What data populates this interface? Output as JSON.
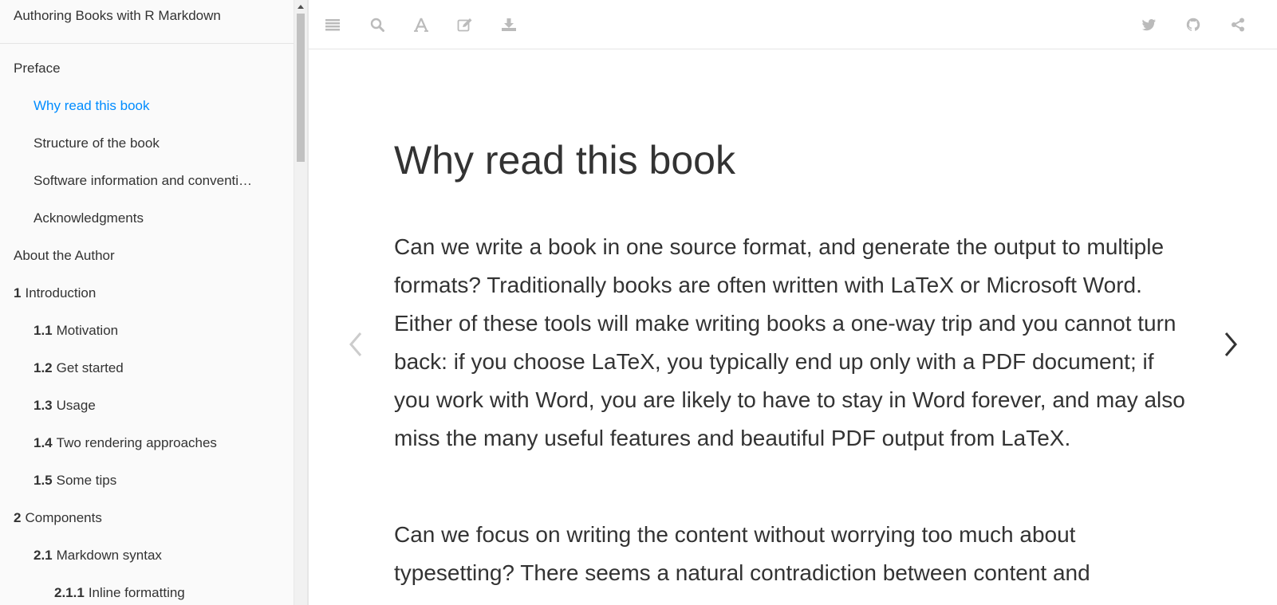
{
  "sidebar": {
    "title": "Authoring Books with R Markdown",
    "items": [
      {
        "number": "",
        "label": "Preface",
        "level": 1
      },
      {
        "number": "",
        "label": "Why read this book",
        "level": 2,
        "active": true
      },
      {
        "number": "",
        "label": "Structure of the book",
        "level": 2
      },
      {
        "number": "",
        "label": "Software information and conventi…",
        "level": 2
      },
      {
        "number": "",
        "label": "Acknowledgments",
        "level": 2
      },
      {
        "number": "",
        "label": "About the Author",
        "level": 1
      },
      {
        "number": "1",
        "label": "Introduction",
        "level": 1
      },
      {
        "number": "1.1",
        "label": "Motivation",
        "level": 2
      },
      {
        "number": "1.2",
        "label": "Get started",
        "level": 2
      },
      {
        "number": "1.3",
        "label": "Usage",
        "level": 2
      },
      {
        "number": "1.4",
        "label": "Two rendering approaches",
        "level": 2
      },
      {
        "number": "1.5",
        "label": "Some tips",
        "level": 2
      },
      {
        "number": "2",
        "label": "Components",
        "level": 1
      },
      {
        "number": "2.1",
        "label": "Markdown syntax",
        "level": 2
      },
      {
        "number": "2.1.1",
        "label": "Inline formatting",
        "level": 3
      }
    ]
  },
  "toolbar": {
    "left_icons": [
      "menu-icon",
      "search-icon",
      "font-icon",
      "edit-icon",
      "download-icon"
    ],
    "right_icons": [
      "twitter-icon",
      "github-icon",
      "share-icon"
    ],
    "icon_color": "#bbbbbb"
  },
  "main": {
    "title": "Why read this book",
    "paragraphs": [
      "Can we write a book in one source format, and generate the output to multiple formats? Traditionally books are often written with LaTeX or Microsoft Word. Either of these tools will make writing books a one-way trip and you cannot turn back: if you choose LaTeX, you typically end up only with a PDF document; if you work with Word, you are likely to have to stay in Word forever, and may also miss the many useful features and beautiful PDF output from LaTeX.",
      "Can we focus on writing the content without worrying too much about typesetting? There seems a natural contradiction between content and"
    ]
  },
  "colors": {
    "accent": "#008cff",
    "text": "#333333",
    "sidebar_bg": "#fafafa"
  }
}
